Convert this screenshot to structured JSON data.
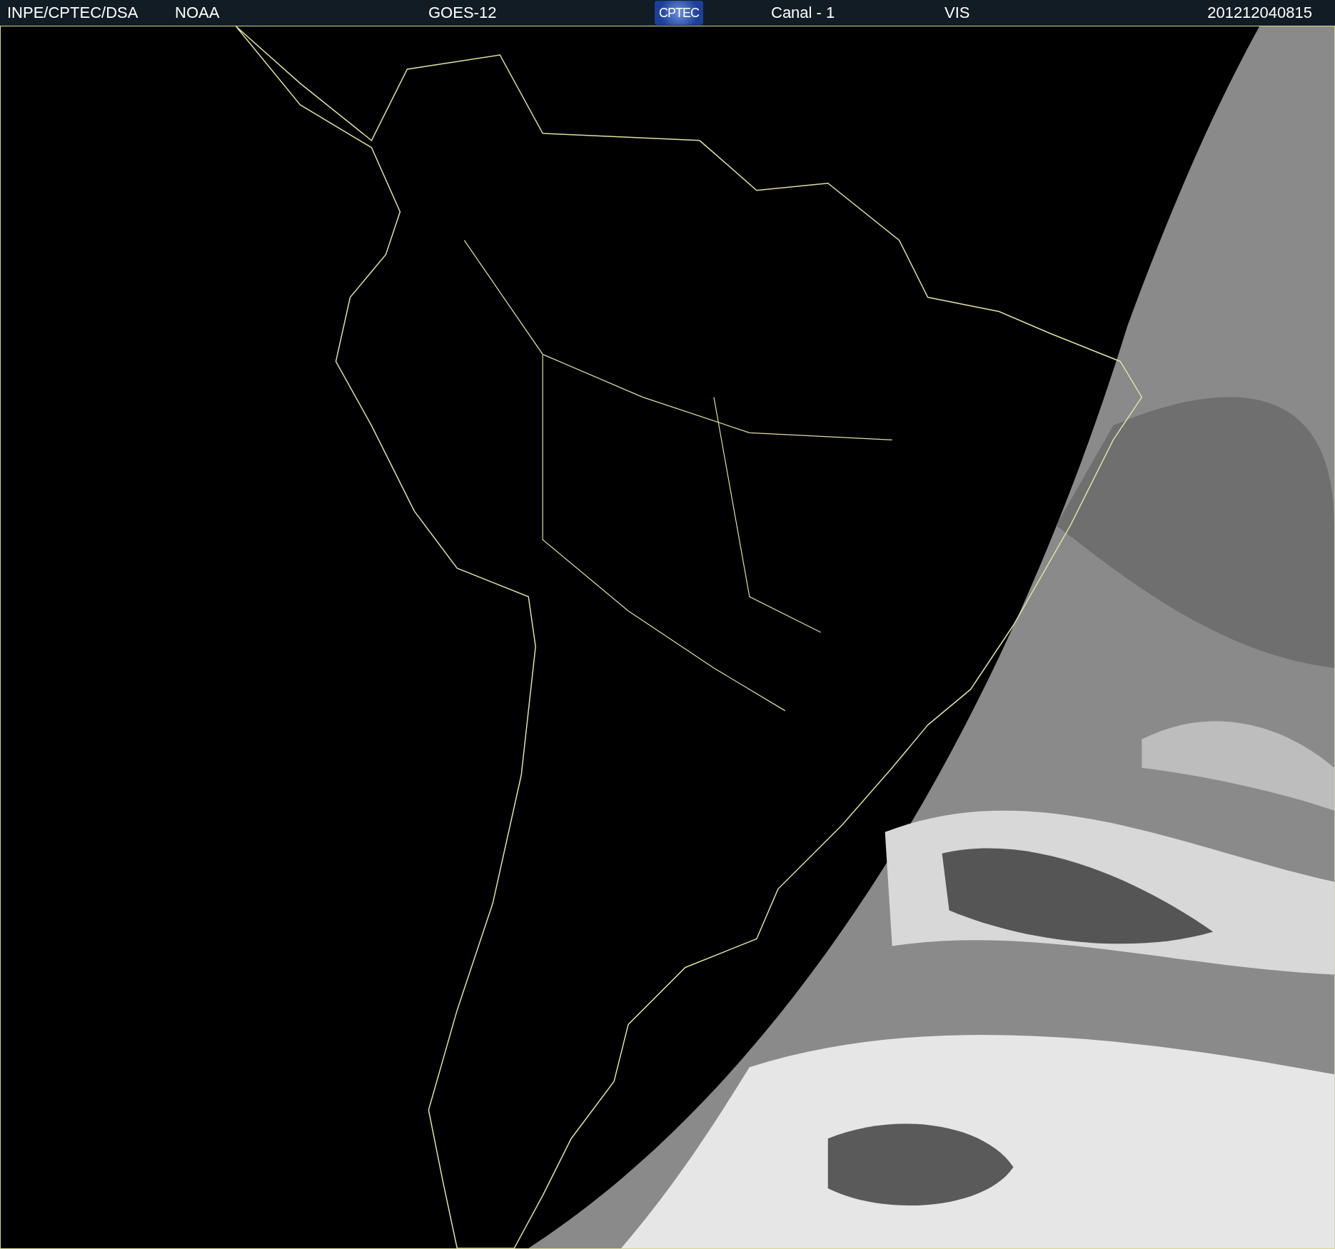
{
  "header": {
    "source": "INPE/CPTEC/DSA",
    "agency": "NOAA",
    "satellite": "GOES-12",
    "logo": "CPTEC",
    "channel": "Canal - 1",
    "band": "VIS",
    "timestamp": "201212040815"
  }
}
